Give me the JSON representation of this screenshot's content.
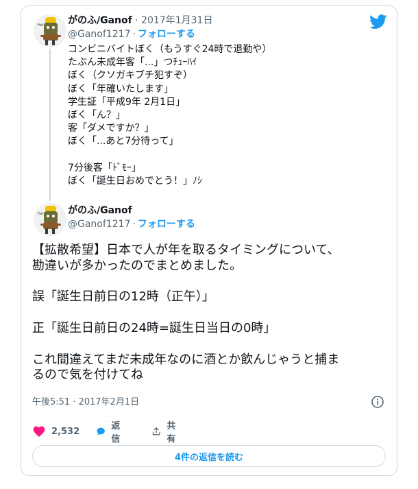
{
  "quoted_tweet": {
    "display_name": "がのふ/Ganof",
    "handle": "@Ganof1217",
    "date": "2017年1月31日",
    "follow_label": "フォローする",
    "text": "コンビニバイトぼく（もうすぐ24時で退勤や）\nたぶん未成年客「...」つﾁｭｰﾊｲ\nぼく（クソガキブチ犯すぞ）\nぼく「年確いたします」\n学生証「平成9年 2月1日」\nぼく「ん？」\n客「ダメですか？」\nぼく「...あと7分待って」\n\n7分後客「ﾄﾞﾓｰ」\nぼく「誕生日おめでとう！」ﾉｼ"
  },
  "main_tweet": {
    "display_name": "がのふ/Ganof",
    "handle": "@Ganof1217",
    "follow_label": "フォローする",
    "text": "【拡散希望】日本で人が年を取るタイミングについて、\n勘違いが多かったのでまとめました。\n\n誤「誕生日前日の12時（正午）」\n\n正「誕生日前日の24時=誕生日当日の0時」\n\nこれ間違えてまだ未成年なのに酒とか飲んじゃうと捕ま\nるので気を付けてね",
    "timestamp": "午後5:51 · 2017年2月1日"
  },
  "actions": {
    "like_count": "2,532",
    "reply_label": "返信",
    "share_label": "共有"
  },
  "read_replies_label": "4件の返信を読む",
  "colors": {
    "accent": "#1d9bf0",
    "like": "#f91880",
    "text": "#0f1419",
    "muted": "#536471",
    "border": "#cfd9de"
  },
  "icons": [
    "twitter-bird-icon",
    "info-icon",
    "heart-icon",
    "reply-bubble-icon",
    "share-icon"
  ]
}
